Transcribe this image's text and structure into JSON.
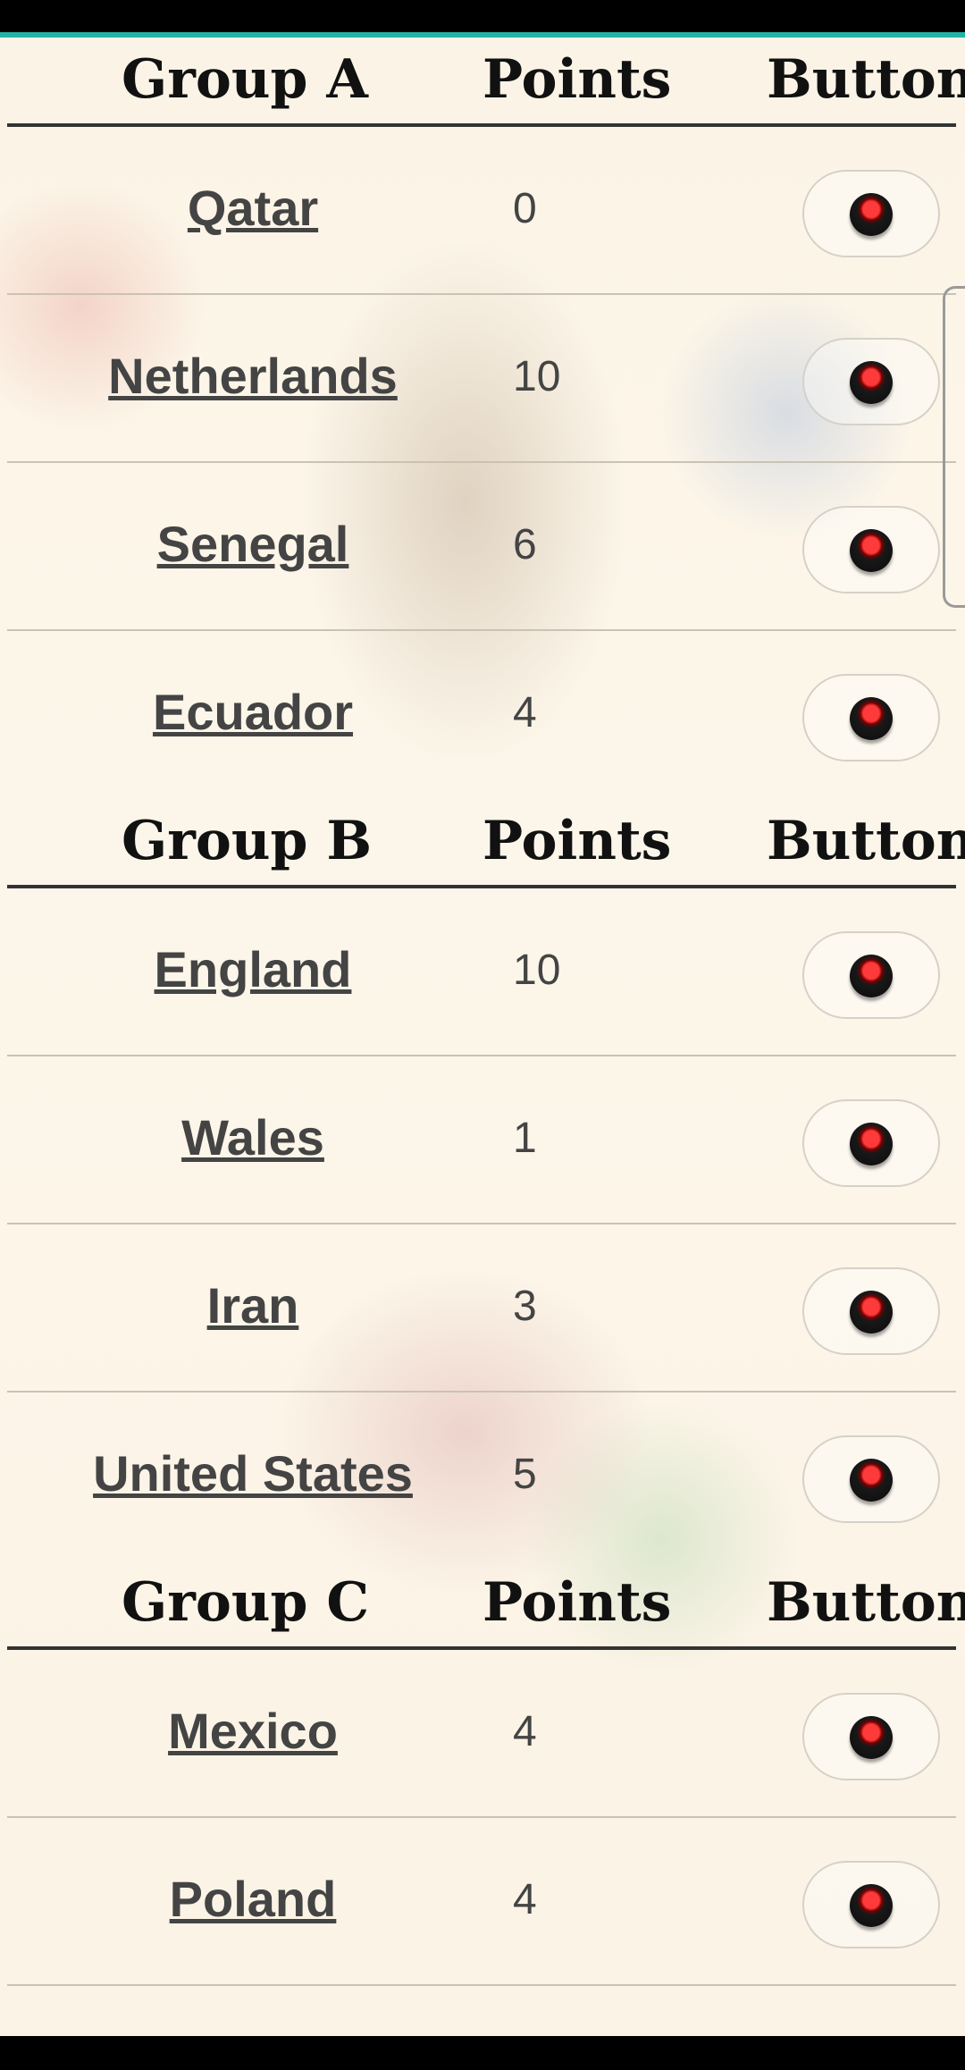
{
  "headers": {
    "points": "Points",
    "button": "Button"
  },
  "groups": [
    {
      "name": "Group A",
      "teams": [
        {
          "name": "Qatar",
          "points": "0"
        },
        {
          "name": "Netherlands",
          "points": "10"
        },
        {
          "name": "Senegal",
          "points": "6"
        },
        {
          "name": "Ecuador",
          "points": "4"
        }
      ]
    },
    {
      "name": "Group B",
      "teams": [
        {
          "name": "England",
          "points": "10"
        },
        {
          "name": "Wales",
          "points": "1"
        },
        {
          "name": "Iran",
          "points": "3"
        },
        {
          "name": "United States",
          "points": "5"
        }
      ]
    },
    {
      "name": "Group C",
      "teams": [
        {
          "name": "Mexico",
          "points": "4"
        },
        {
          "name": "Poland",
          "points": "4"
        }
      ]
    }
  ],
  "icons": {
    "row_button": "red-push-button-icon"
  },
  "colors": {
    "accent": "#23b3a6",
    "button_red": "#ff3a3a"
  }
}
